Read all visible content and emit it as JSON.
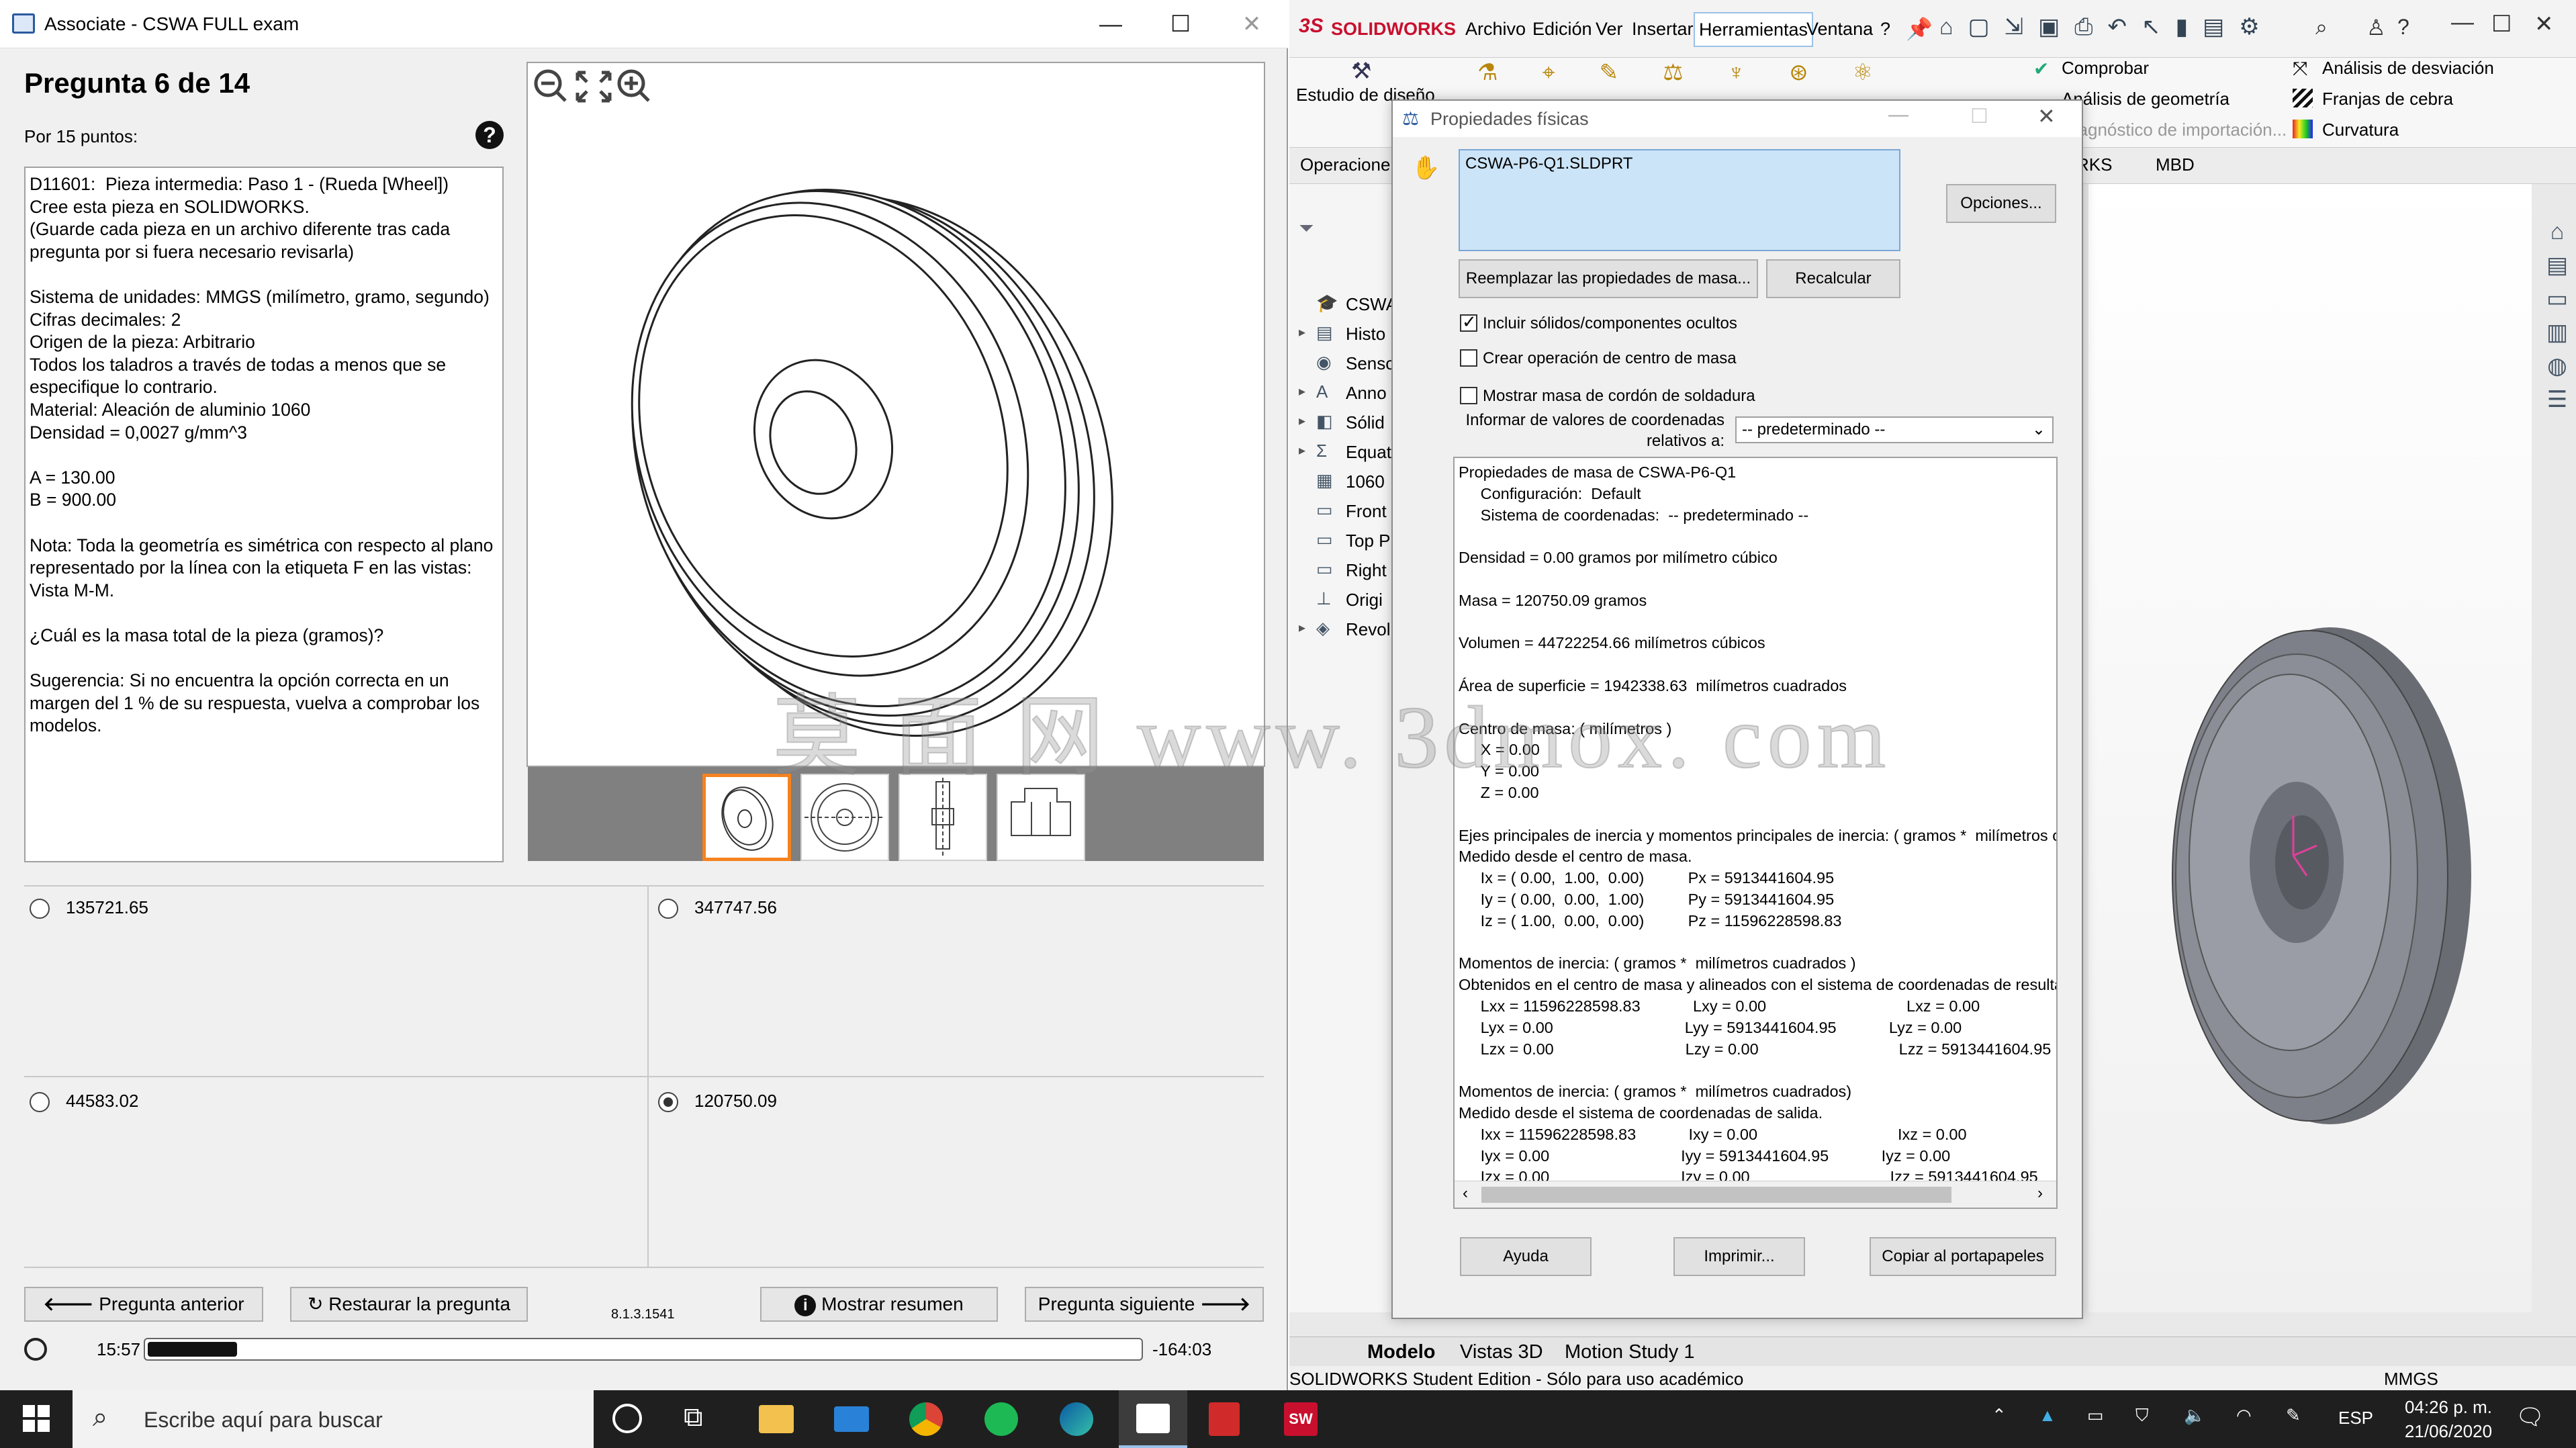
{
  "exam": {
    "window_title": "Associate - CSWA FULL exam",
    "question_title": "Pregunta 6 de 14",
    "points": "Por 15 puntos:",
    "help_glyph": "?",
    "question_text": "D11601:  Pieza intermedia: Paso 1 - (Rueda [Wheel])\nCree esta pieza en SOLIDWORKS.\n(Guarde cada pieza en un archivo diferente tras cada\npregunta por si fuera necesario revisarla)\n\nSistema de unidades: MMGS (milímetro, gramo, segundo)\nCifras decimales: 2\nOrigen de la pieza: Arbitrario\nTodos los taladros a través de todas a menos que se\nespecifique lo contrario.\nMaterial: Aleación de aluminio 1060\nDensidad = 0,0027 g/mm^3\n\nA = 130.00\nB = 900.00\n\nNota: Toda la geometría es simétrica con respecto al plano\nrepresentado por la línea con la etiqueta F en las vistas:\nVista M-M.\n\n¿Cuál es la masa total de la pieza (gramos)?\n\nSugerencia: Si no encuentra la opción correcta en un\nmargen del 1 % de su respuesta, vuelva a comprobar los\nmodelos.",
    "options": [
      {
        "value": "135721.65",
        "selected": false
      },
      {
        "value": "347747.56",
        "selected": false
      },
      {
        "value": "44583.02",
        "selected": false
      },
      {
        "value": "120750.09",
        "selected": true
      }
    ],
    "buttons": {
      "prev": "Pregunta anterior",
      "restore": "Restaurar la pregunta",
      "summary": "Mostrar resumen",
      "next": "Pregunta siguiente"
    },
    "version": "8.1.3.1541",
    "timer": {
      "elapsed": "15:57",
      "remaining": "-164:03",
      "progress": 0.09
    }
  },
  "solidworks": {
    "brand": "SOLIDWORKS",
    "menu": [
      "Archivo",
      "Edición",
      "Ver",
      "Insertar",
      "Herramientas",
      "Ventana",
      "?"
    ],
    "menu_active": "Herramientas",
    "ribbon_design_study": "Estudio de diseño",
    "ribbon_right": [
      "Comprobar",
      "Análisis de geometría",
      "Diagnóstico de importación...",
      "Análisis de desviación",
      "Franjas de cebra",
      "Curvatura"
    ],
    "tab_operaciones": "Operacione",
    "tabs_right": [
      "RKS",
      "MBD"
    ],
    "tree": [
      "CSWA",
      "Histo",
      "Senso",
      "Anno",
      "Sólid",
      "Equat",
      "1060",
      "Front",
      "Top P",
      "Right",
      "Origi",
      "Revol"
    ],
    "bottom_tabs": [
      "Modelo",
      "Vistas 3D",
      "Motion Study 1"
    ],
    "status_text": "SOLIDWORKS Student Edition - Sólo para uso académico",
    "units": "MMGS",
    "accent_red": "#c8102e"
  },
  "dialog": {
    "title": "Propiedades físicas",
    "file": "CSWA-P6-Q1.SLDPRT",
    "options_btn": "Opciones...",
    "replace_btn": "Reemplazar las propiedades de masa...",
    "recalc_btn": "Recalcular",
    "checks": [
      {
        "label": "Incluir sólidos/componentes ocultos",
        "checked": true
      },
      {
        "label": "Crear operación de centro de masa",
        "checked": false
      },
      {
        "label": "Mostrar masa de cordón de soldadura",
        "checked": false
      }
    ],
    "coord_label": "Informar de valores de coordenadas\nrelativos a:",
    "coord_value": "-- predeterminado --",
    "results": "Propiedades de masa de CSWA-P6-Q1\n     Configuración:  Default\n     Sistema de coordenadas:  -- predeterminado --\n\nDensidad = 0.00 gramos por milímetro cúbico\n\nMasa = 120750.09 gramos\n\nVolumen = 44722254.66 milímetros cúbicos\n\nÁrea de superficie = 1942338.63  milímetros cuadrados\n\nCentro de masa: ( milímetros )\n     X = 0.00\n     Y = 0.00\n     Z = 0.00\n\nEjes principales de inercia y momentos principales de inercia: ( gramos *  milímetros cuadrados )\nMedido desde el centro de masa.\n     Ix = ( 0.00,  1.00,  0.00)          Px = 5913441604.95\n     Iy = ( 0.00,  0.00,  1.00)          Py = 5913441604.95\n     Iz = ( 1.00,  0.00,  0.00)          Pz = 11596228598.83\n\nMomentos de inercia: ( gramos *  milímetros cuadrados )\nObtenidos en el centro de masa y alineados con el sistema de coordenadas de resultados.\n     Lxx = 11596228598.83            Lxy = 0.00                                Lxz = 0.00\n     Lyx = 0.00                              Lyy = 5913441604.95            Lyz = 0.00\n     Lzx = 0.00                              Lzy = 0.00                                Lzz = 5913441604.95\n\nMomentos de inercia: ( gramos *  milímetros cuadrados)\nMedido desde el sistema de coordenadas de salida.\n     Ixx = 11596228598.83            Ixy = 0.00                                Ixz = 0.00\n     Iyx = 0.00                              Iyy = 5913441604.95            Iyz = 0.00\n     Izx = 0.00                              Izy = 0.00                                Izz = 5913441604.95",
    "help_btn": "Ayuda",
    "print_btn": "Imprimir...",
    "copy_btn": "Copiar al portapapeles"
  },
  "taskbar": {
    "search_placeholder": "Escribe aquí para buscar",
    "lang": "ESP",
    "time": "04:26 p. m.",
    "date": "21/06/2020"
  },
  "watermark": "莫 面 网 www. 3dmox. com"
}
